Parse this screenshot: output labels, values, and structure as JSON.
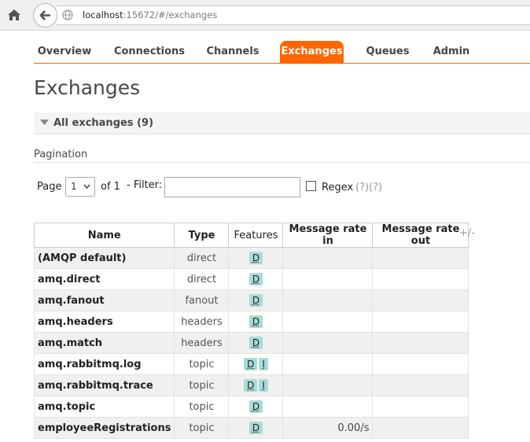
{
  "browser": {
    "url_host": "localhost",
    "url_rest": ":15672/#/exchanges"
  },
  "nav": {
    "tabs": [
      {
        "label": "Overview"
      },
      {
        "label": "Connections"
      },
      {
        "label": "Channels"
      },
      {
        "label": "Exchanges"
      },
      {
        "label": "Queues"
      },
      {
        "label": "Admin"
      }
    ],
    "active": "Exchanges"
  },
  "page_title": "Exchanges",
  "section": {
    "label": "All exchanges (9)"
  },
  "pagination": {
    "label": "Pagination",
    "page_label": "Page",
    "page_value": "1",
    "of_label": "of 1",
    "filter_label": "- Filter:",
    "filter_value": "",
    "regex_label": "Regex",
    "help_text": "(?)(?)"
  },
  "table": {
    "columns": [
      "Name",
      "Type",
      "Features",
      "Message rate in",
      "Message rate out"
    ],
    "plus_minus": "+/-",
    "rows": [
      {
        "name": "(AMQP default)",
        "type": "direct",
        "features": [
          "D"
        ],
        "rate_in": "",
        "rate_out": ""
      },
      {
        "name": "amq.direct",
        "type": "direct",
        "features": [
          "D"
        ],
        "rate_in": "",
        "rate_out": ""
      },
      {
        "name": "amq.fanout",
        "type": "fanout",
        "features": [
          "D"
        ],
        "rate_in": "",
        "rate_out": ""
      },
      {
        "name": "amq.headers",
        "type": "headers",
        "features": [
          "D"
        ],
        "rate_in": "",
        "rate_out": ""
      },
      {
        "name": "amq.match",
        "type": "headers",
        "features": [
          "D"
        ],
        "rate_in": "",
        "rate_out": ""
      },
      {
        "name": "amq.rabbitmq.log",
        "type": "topic",
        "features": [
          "D",
          "I"
        ],
        "rate_in": "",
        "rate_out": ""
      },
      {
        "name": "amq.rabbitmq.trace",
        "type": "topic",
        "features": [
          "D",
          "I"
        ],
        "rate_in": "",
        "rate_out": ""
      },
      {
        "name": "amq.topic",
        "type": "topic",
        "features": [
          "D"
        ],
        "rate_in": "",
        "rate_out": ""
      },
      {
        "name": "employeeRegistrations",
        "type": "topic",
        "features": [
          "D"
        ],
        "rate_in": "0.00/s",
        "rate_out": ""
      }
    ]
  },
  "colors": {
    "accent": "#ff6600",
    "badge": "#a8dcd8"
  }
}
